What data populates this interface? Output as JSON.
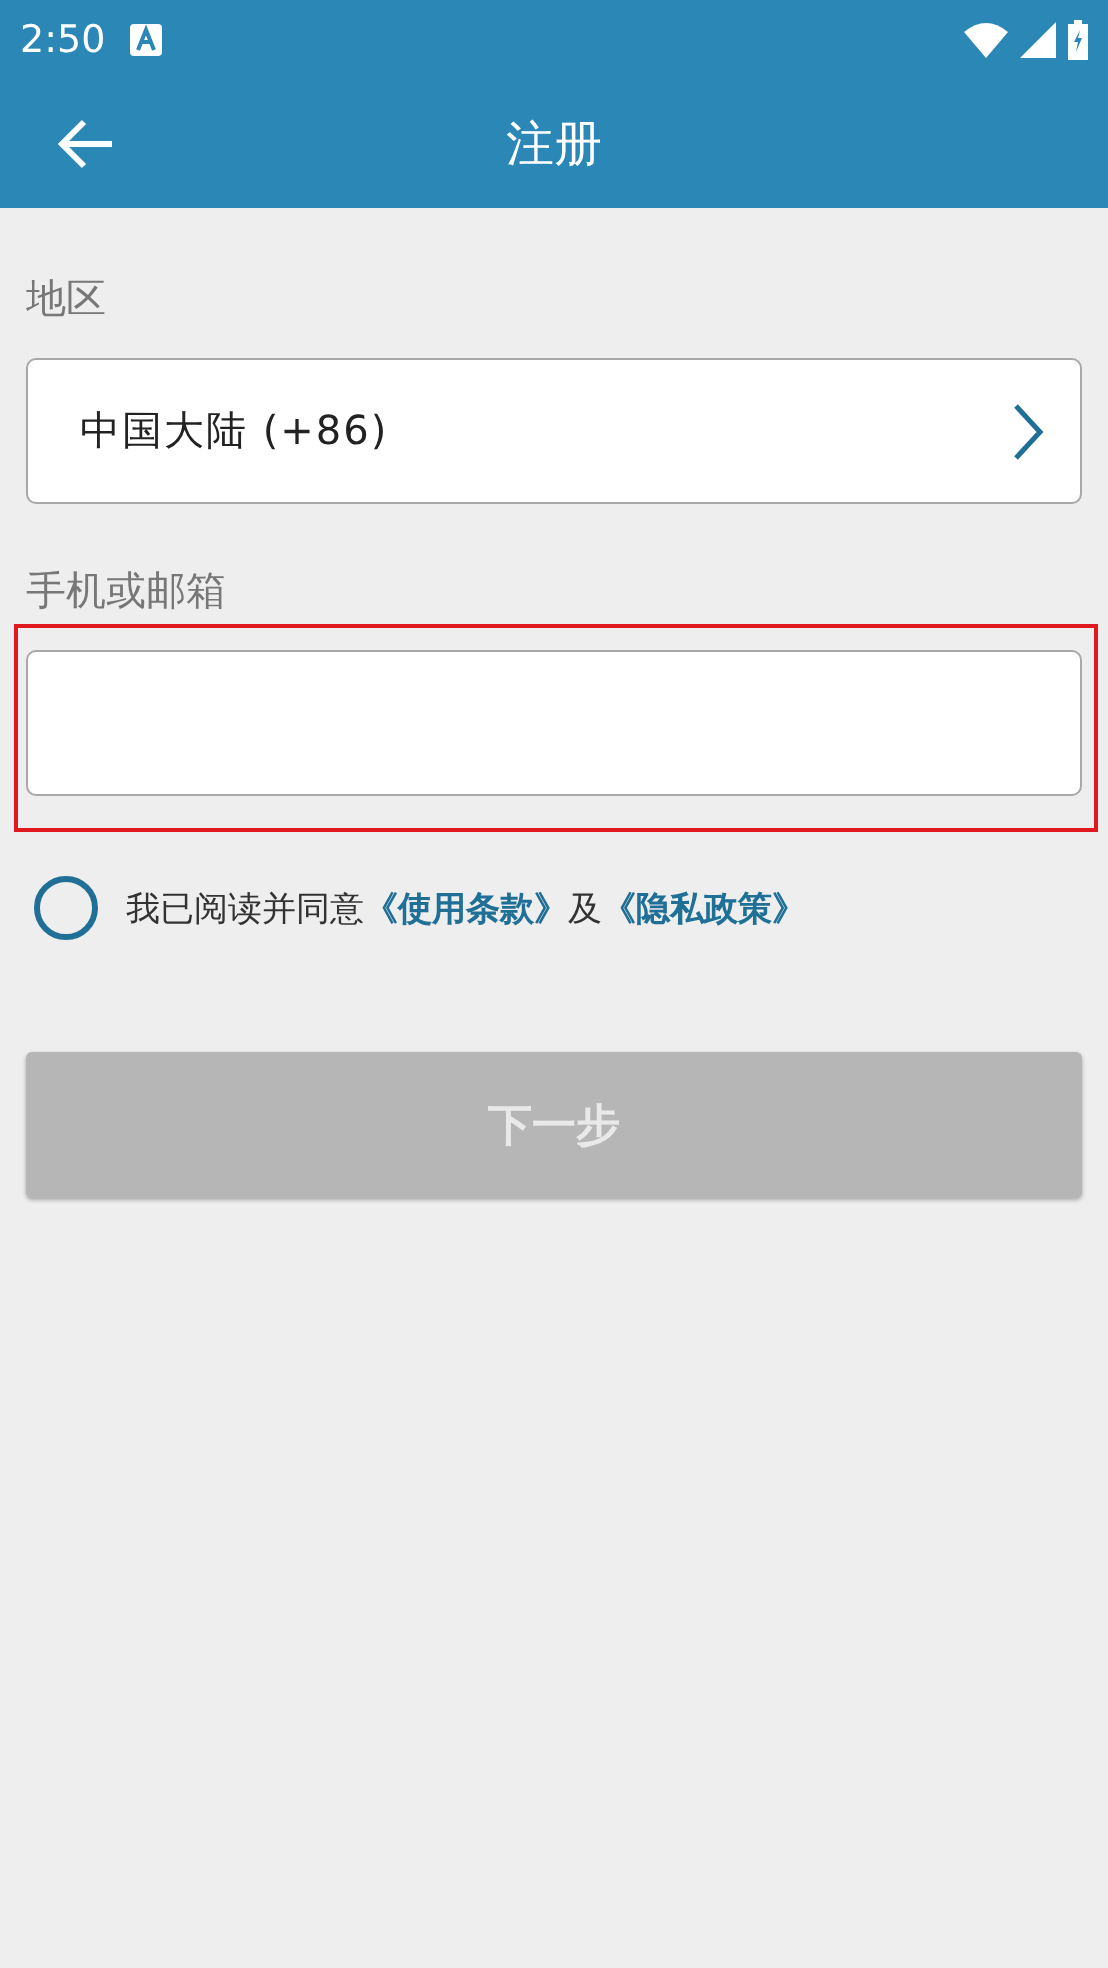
{
  "status_bar": {
    "time": "2:50"
  },
  "app_bar": {
    "title": "注册"
  },
  "region": {
    "label": "地区",
    "value": "中国大陆 (+86)"
  },
  "account": {
    "label": "手机或邮箱",
    "highlighted": true
  },
  "agreement": {
    "checked": false,
    "parts": [
      {
        "kind": "text",
        "text": "我已阅读并同意"
      },
      {
        "kind": "link",
        "text": "《使用条款》"
      },
      {
        "kind": "text",
        "text": "及"
      },
      {
        "kind": "link",
        "text": "《隐私政策》"
      }
    ]
  },
  "next_button": {
    "label": "下一步",
    "disabled": true
  }
}
